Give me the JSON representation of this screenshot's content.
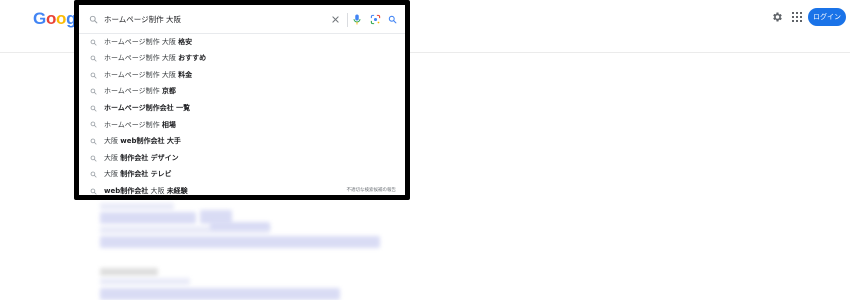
{
  "logo": {
    "text": "Google",
    "letters": [
      {
        "ch": "G",
        "color": "#4285F4"
      },
      {
        "ch": "o",
        "color": "#EA4335"
      },
      {
        "ch": "o",
        "color": "#FBBC05"
      },
      {
        "ch": "g",
        "color": "#4285F4"
      },
      {
        "ch": "l",
        "color": "#34A853"
      },
      {
        "ch": "e",
        "color": "#EA4335"
      }
    ]
  },
  "search": {
    "query": "ホームページ制作 大阪",
    "highlight_color": "#000000"
  },
  "suggestions": [
    {
      "base": "ホームページ制作 大阪 ",
      "completion": "格安"
    },
    {
      "base": "ホームページ制作 大阪 ",
      "completion": "おすすめ"
    },
    {
      "base": "ホームページ制作 大阪 ",
      "completion": "料金"
    },
    {
      "base": "ホームページ制作 ",
      "completion": "京都"
    },
    {
      "base": "",
      "completion": "ホームページ制作会社 一覧"
    },
    {
      "base": "ホームページ制作 ",
      "completion": "相場"
    },
    {
      "base": "大阪 ",
      "completion": "web制作会社 大手"
    },
    {
      "base": "大阪 ",
      "completion": "制作会社 デザイン"
    },
    {
      "base": "大阪 ",
      "completion": "制作会社 テレビ"
    },
    {
      "base": "",
      "completion": "web制作会社",
      "tail_base": " 大阪 ",
      "tail_completion": "未経験"
    }
  ],
  "report_text": "不適切な検索候補の報告",
  "header": {
    "settings_icon": "gear-icon",
    "apps_icon": "apps-grid-icon",
    "login_label": "ログイン",
    "accent": "#1a73e8"
  }
}
